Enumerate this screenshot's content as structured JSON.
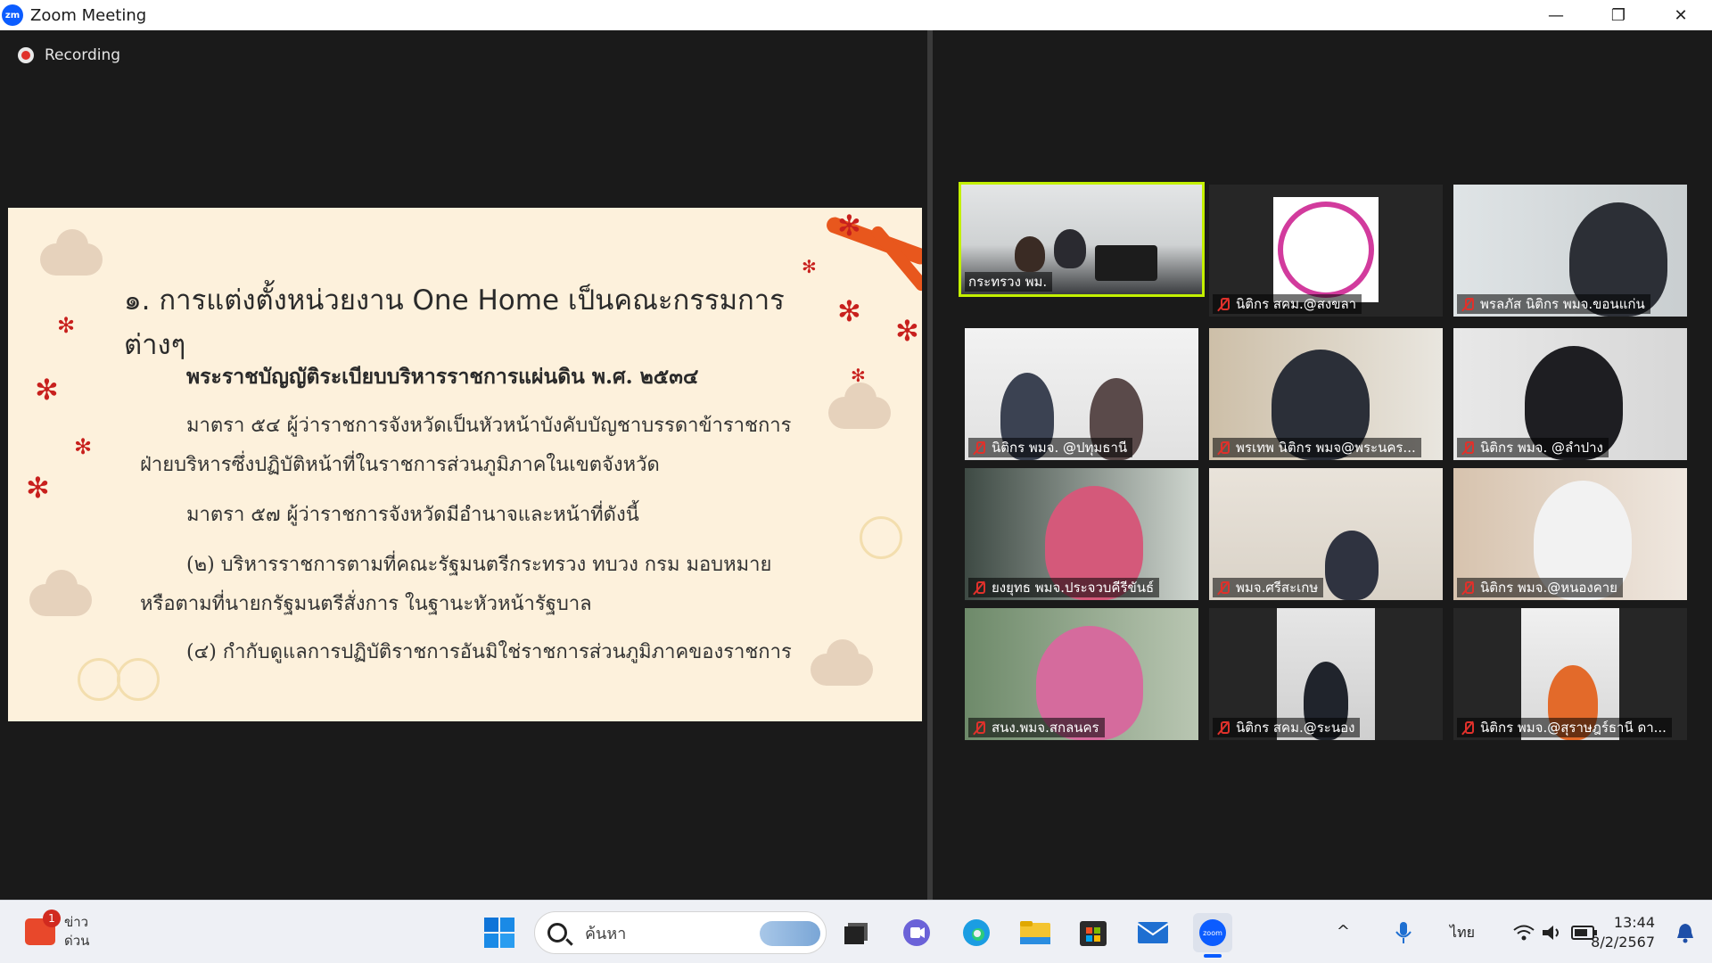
{
  "window": {
    "app_icon_text": "zm",
    "title": "Zoom Meeting",
    "minimize_glyph": "—",
    "restore_glyph": "❐",
    "close_glyph": "✕"
  },
  "meeting": {
    "recording_label": "Recording",
    "slide": {
      "title": "๑. การแต่งตั้งหน่วยงาน One Home เป็นคณะกรรมการต่างๆ",
      "subtitle": "พระราชบัญญัติระเบียบบริหารราชการแผ่นดิน พ.ศ. ๒๕๓๔",
      "lines": [
        "มาตรา ๕๔ ผู้ว่าราชการจังหวัดเป็นหัวหน้าบังคับบัญชาบรรดาข้าราชการ",
        "ฝ่ายบริหารซึ่งปฏิบัติหน้าที่ในราชการส่วนภูมิภาคในเขตจังหวัด",
        "มาตรา ๕๗ ผู้ว่าราชการจังหวัดมีอำนาจและหน้าที่ดังนี้",
        "(๒) บริหารราชการตามที่คณะรัฐมนตรีกระทรวง ทบวง กรม มอบหมาย",
        "หรือตามที่นายกรัฐมนตรีสั่งการ ในฐานะหัวหน้ารัฐบาล",
        "(๔) กำกับดูแลการปฏิบัติราชการอันมิใช่ราชการส่วนภูมิภาคของราชการ"
      ]
    },
    "participants": [
      {
        "name": "กระทรวง พม.",
        "muted": false,
        "active": true
      },
      {
        "name": "นิติกร สคม.@สงขลา",
        "muted": true,
        "active": false
      },
      {
        "name": "พรลภัส นิติกร พมจ.ขอนแก่น",
        "muted": true,
        "active": false
      },
      {
        "name": "นิติกร พมจ. @ปทุมธานี",
        "muted": true,
        "active": false
      },
      {
        "name": "พรเทพ นิติกร พมจ@พระนคร...",
        "muted": true,
        "active": false
      },
      {
        "name": "นิติกร พมจ. @ลำปาง",
        "muted": true,
        "active": false
      },
      {
        "name": "ยงยุทธ พมจ.ประจวบคีรีขันธ์",
        "muted": true,
        "active": false
      },
      {
        "name": "พมจ.ศรีสะเกษ",
        "muted": true,
        "active": false
      },
      {
        "name": "นิติกร พมจ.@หนองคาย",
        "muted": true,
        "active": false
      },
      {
        "name": "สนง.พมจ.สกลนคร",
        "muted": true,
        "active": false
      },
      {
        "name": "นิติกร สคม.@ระนอง",
        "muted": true,
        "active": false
      },
      {
        "name": "นิติกร พมจ.@สุราษฎร์ธานี ดา...",
        "muted": true,
        "active": false
      }
    ]
  },
  "taskbar": {
    "news_badge": "1",
    "news_line1": "ข่าว",
    "news_line2": "ด่วน",
    "search_placeholder": "ค้นหา",
    "zoom_icon_text": "zoom",
    "tray_chevron": "^",
    "language": "ไทย",
    "time": "13:44",
    "date": "8/2/2567"
  }
}
